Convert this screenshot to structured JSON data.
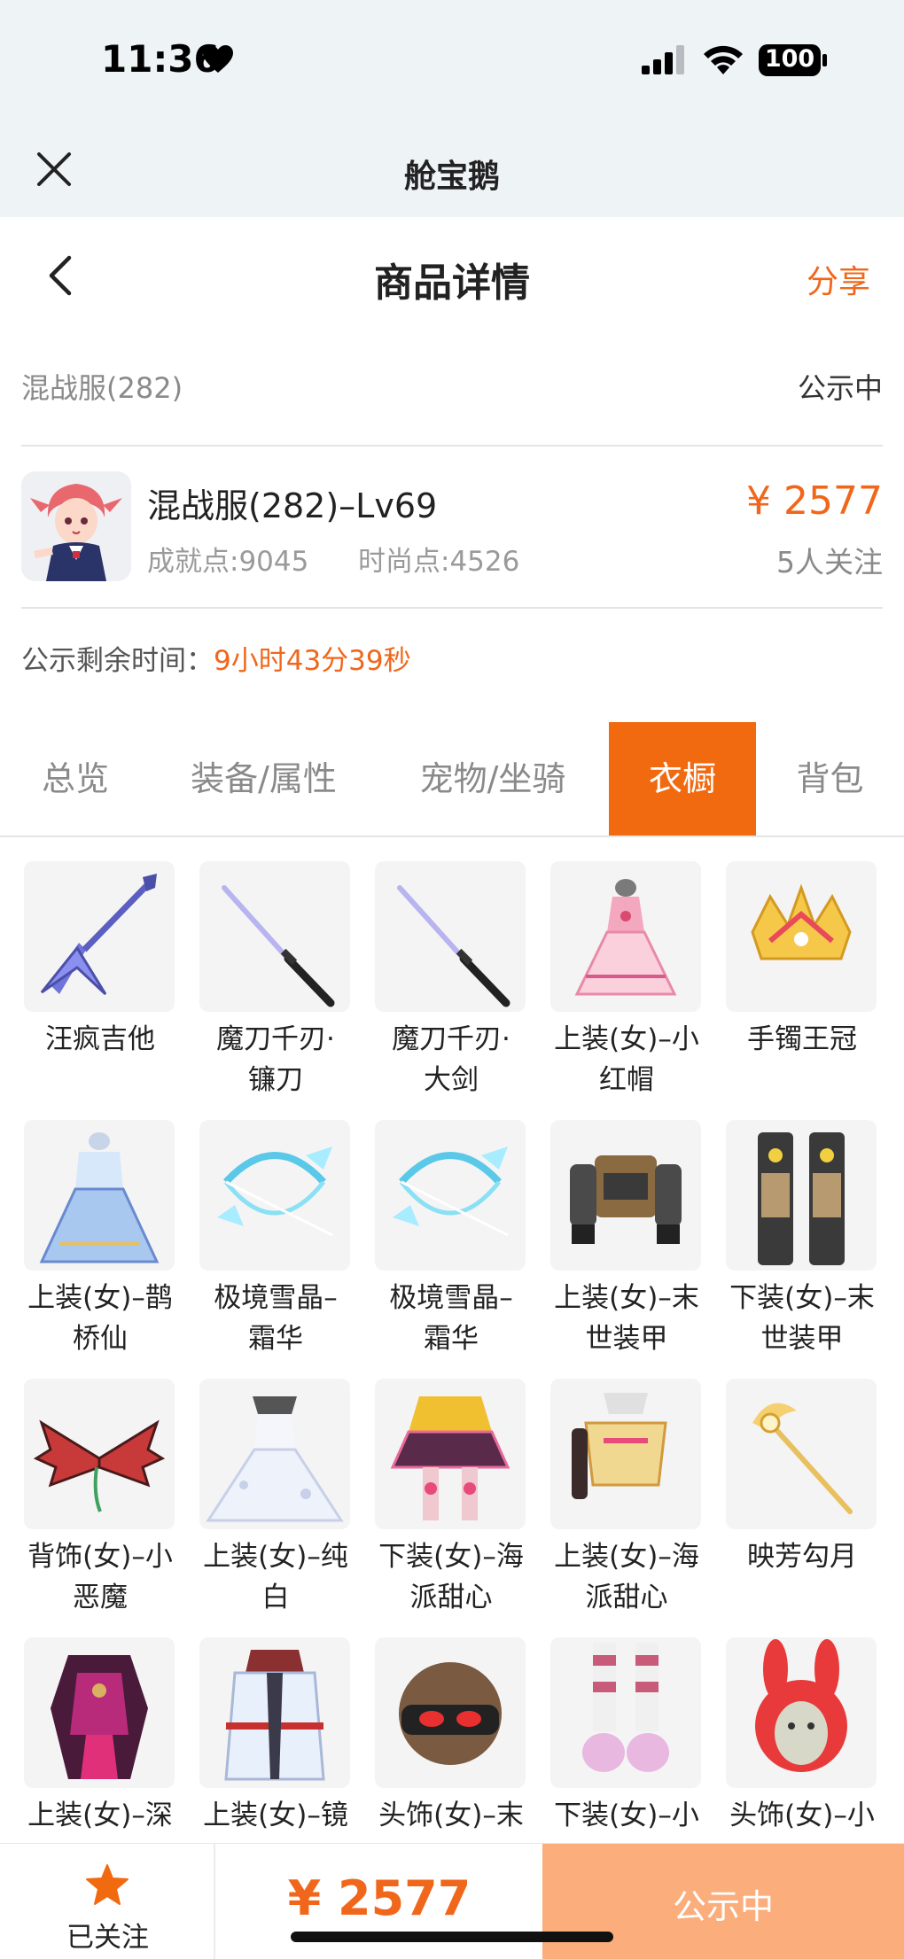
{
  "status_bar": {
    "time": "11:36",
    "battery": "100"
  },
  "app": {
    "title": "舱宝鹅"
  },
  "nav": {
    "title": "商品详情",
    "share": "分享"
  },
  "server": {
    "name": "混战服(282)",
    "status": "公示中"
  },
  "product": {
    "title": "混战服(282)–Lv69",
    "achievement": "成就点:9045",
    "fashion": "时尚点:4526",
    "price": "¥ 2577",
    "followers": "5人关注"
  },
  "timer": {
    "label": "公示剩余时间：",
    "value": "9小时43分39秒"
  },
  "tabs": [
    {
      "label": "总览"
    },
    {
      "label": "装备/属性"
    },
    {
      "label": "宠物/坐骑"
    },
    {
      "label": "衣橱"
    },
    {
      "label": "背包"
    }
  ],
  "active_tab": "衣橱",
  "wardrobe": [
    {
      "line1": "汪疯吉他",
      "line2": "",
      "icon": "guitar-icon"
    },
    {
      "line1": "魔刀千刃·",
      "line2": "镰刀",
      "icon": "katana-icon"
    },
    {
      "line1": "魔刀千刃·",
      "line2": "大剑",
      "icon": "katana-icon"
    },
    {
      "line1": "上装(女)–小",
      "line2": "红帽",
      "icon": "dress-icon"
    },
    {
      "line1": "手镯王冠",
      "line2": "",
      "icon": "crown-bracelet-icon"
    },
    {
      "line1": "上装(女)–鹊",
      "line2": "桥仙",
      "icon": "gown-icon"
    },
    {
      "line1": "极境雪晶–",
      "line2": "霜华",
      "icon": "crystal-bow-icon"
    },
    {
      "line1": "极境雪晶–",
      "line2": "霜华",
      "icon": "crystal-bow-icon"
    },
    {
      "line1": "上装(女)–末",
      "line2": "世装甲",
      "icon": "armor-top-icon"
    },
    {
      "line1": "下装(女)–末",
      "line2": "世装甲",
      "icon": "armor-legs-icon"
    },
    {
      "line1": "背饰(女)–小",
      "line2": "恶魔",
      "icon": "demon-wings-icon"
    },
    {
      "line1": "上装(女)–纯",
      "line2": "白",
      "icon": "white-dress-icon"
    },
    {
      "line1": "下装(女)–海",
      "line2": "派甜心",
      "icon": "skirt-icon"
    },
    {
      "line1": "上装(女)–海",
      "line2": "派甜心",
      "icon": "top-icon"
    },
    {
      "line1": "映芳勾月",
      "line2": "",
      "icon": "golden-staff-icon"
    },
    {
      "line1": "上装(女)–深",
      "line2": "",
      "icon": "dark-armor-icon"
    },
    {
      "line1": "上装(女)–镜",
      "line2": "",
      "icon": "kimono-icon"
    },
    {
      "line1": "头饰(女)–末",
      "line2": "",
      "icon": "helmet-icon"
    },
    {
      "line1": "下装(女)–小",
      "line2": "",
      "icon": "socks-shoes-icon"
    },
    {
      "line1": "头饰(女)–小",
      "line2": "",
      "icon": "bunny-hood-icon"
    }
  ],
  "bottom": {
    "follow_label": "已关注",
    "price": "¥ 2577",
    "status_label": "公示中"
  },
  "colors": {
    "accent": "#f0671b",
    "tab_active_bg": "#f26a10",
    "status_btn_bg": "#fbad7c"
  }
}
